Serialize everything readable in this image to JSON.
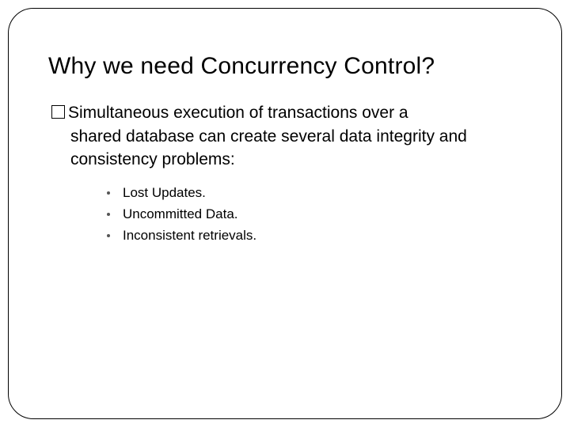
{
  "slide": {
    "title": "Why we need Concurrency Control?",
    "paragraph_first": "Simultaneous execution of transactions over a",
    "paragraph_rest": "shared database can create several data integrity and consistency problems:",
    "bullets": {
      "b1": "Lost Updates.",
      "b2": "Uncommitted Data.",
      "b3": "Inconsistent retrievals."
    }
  }
}
